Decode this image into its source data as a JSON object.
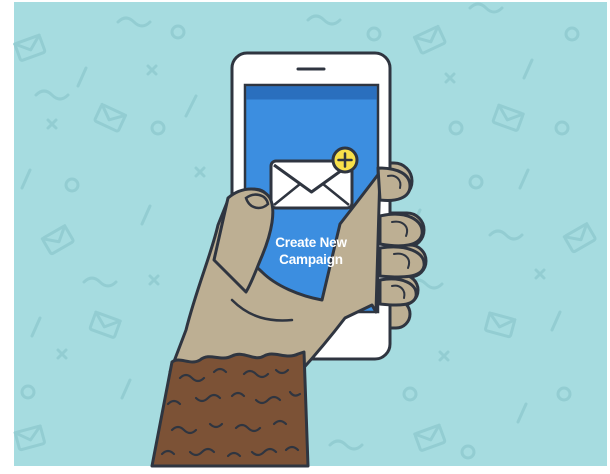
{
  "colors": {
    "background": "#A6DCE0",
    "pattern": "#93CDD2",
    "screen": "#3C8EE0",
    "status_bar": "#2A6FBE",
    "phone_body": "#FFFFFF",
    "outline": "#2F3540",
    "hand": "#BDAF93",
    "sleeve": "#7C5236",
    "badge": "#F7E04A"
  },
  "screen": {
    "cta_line1": "Create New",
    "cta_line2": "Campaign"
  },
  "icons": {
    "compose": "envelope-icon",
    "badge": "plus-icon",
    "home": "home-button-icon"
  }
}
